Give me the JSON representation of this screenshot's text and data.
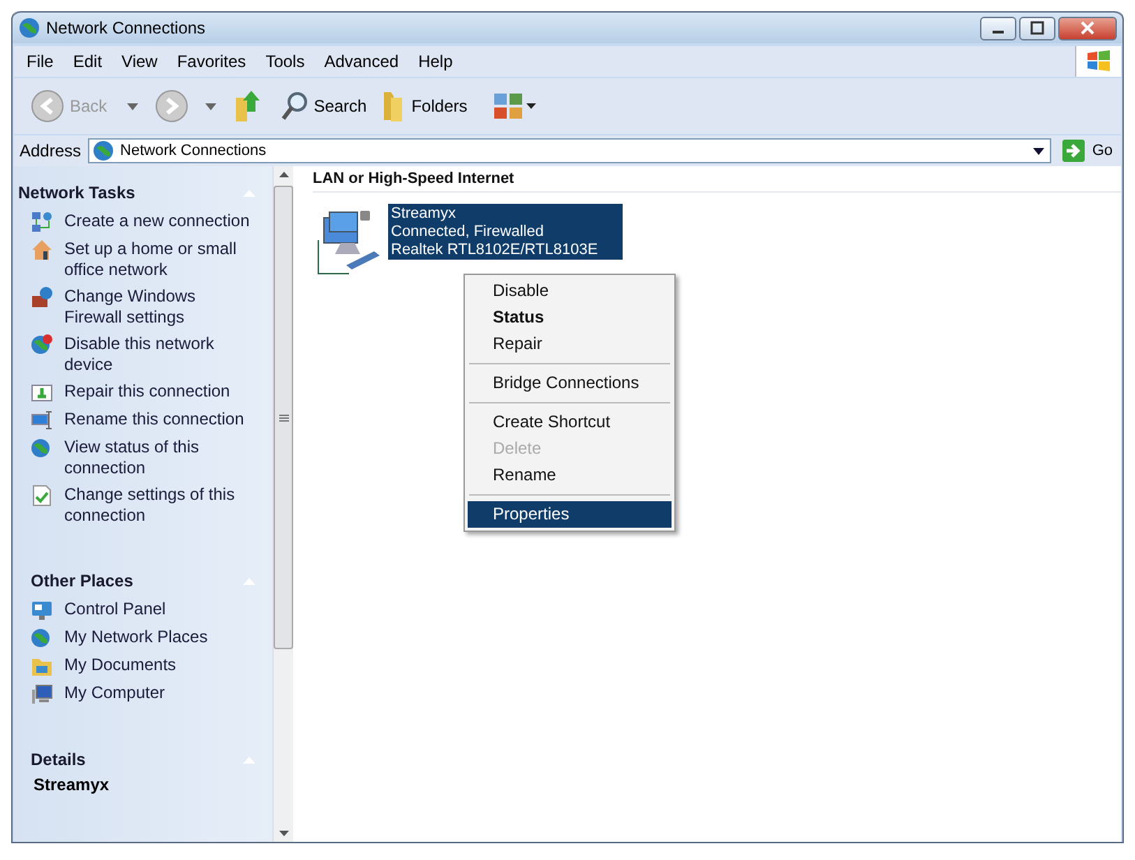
{
  "window": {
    "title": "Network Connections"
  },
  "menu_bar": [
    "File",
    "Edit",
    "View",
    "Favorites",
    "Tools",
    "Advanced",
    "Help"
  ],
  "toolbar": {
    "back": "Back",
    "search": "Search",
    "folders": "Folders"
  },
  "address_bar": {
    "label": "Address",
    "value": "Network Connections",
    "go": "Go"
  },
  "sidebar": {
    "sections": [
      {
        "title": "Network Tasks",
        "items": [
          "Create a new connection",
          "Set up a home or small office network",
          "Change Windows Firewall settings",
          "Disable this network device",
          "Repair this connection",
          "Rename this connection",
          "View status of this connection",
          "Change settings of this connection"
        ]
      },
      {
        "title": "Other Places",
        "items": [
          "Control Panel",
          "My Network Places",
          "My Documents",
          "My Computer"
        ]
      },
      {
        "title": "Details",
        "items": [
          "Streamyx"
        ]
      }
    ]
  },
  "content": {
    "group_title": "LAN or High-Speed Internet",
    "connection": {
      "name": "Streamyx",
      "status": "Connected, Firewalled",
      "device": "Realtek RTL8102E/RTL8103E",
      "selected": true
    }
  },
  "context_menu": [
    {
      "kind": "item",
      "label": "Disable",
      "default": false,
      "disabled": false,
      "selected": false
    },
    {
      "kind": "item",
      "label": "Status",
      "default": true,
      "disabled": false,
      "selected": false
    },
    {
      "kind": "item",
      "label": "Repair",
      "default": false,
      "disabled": false,
      "selected": false
    },
    {
      "kind": "separator"
    },
    {
      "kind": "item",
      "label": "Bridge Connections",
      "default": false,
      "disabled": false,
      "selected": false
    },
    {
      "kind": "separator"
    },
    {
      "kind": "item",
      "label": "Create Shortcut",
      "default": false,
      "disabled": false,
      "selected": false
    },
    {
      "kind": "item",
      "label": "Delete",
      "default": false,
      "disabled": true,
      "selected": false
    },
    {
      "kind": "item",
      "label": "Rename",
      "default": false,
      "disabled": false,
      "selected": false
    },
    {
      "kind": "separator"
    },
    {
      "kind": "item",
      "label": "Properties",
      "default": false,
      "disabled": false,
      "selected": true
    }
  ]
}
